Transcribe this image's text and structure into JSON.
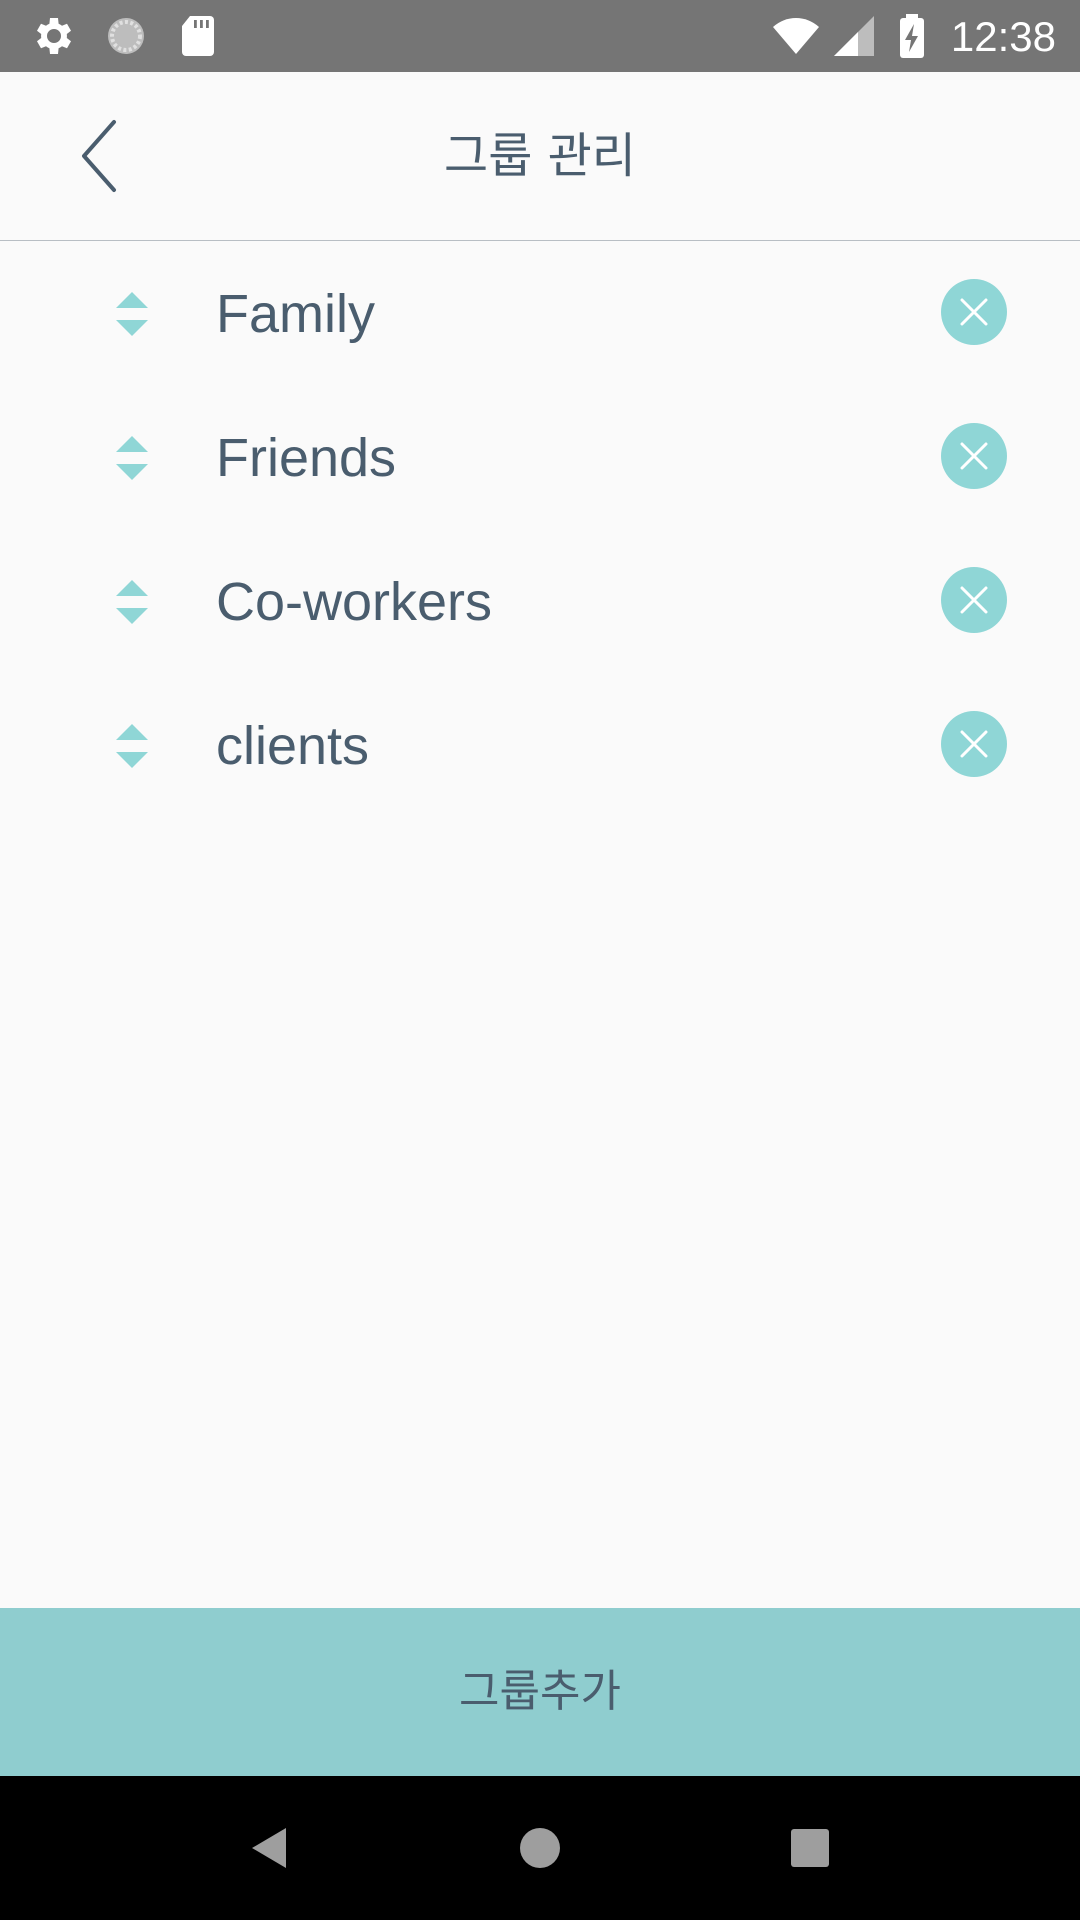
{
  "status_bar": {
    "time": "12:38",
    "icons": [
      "settings-icon",
      "loading-icon",
      "sd-card-icon",
      "wifi-icon",
      "cell-signal-icon",
      "battery-charging-icon"
    ]
  },
  "header": {
    "title": "그룹 관리",
    "back_icon": "chevron-left-icon"
  },
  "groups": [
    {
      "name": "Family"
    },
    {
      "name": "Friends"
    },
    {
      "name": "Co-workers"
    },
    {
      "name": "clients"
    }
  ],
  "add_group_button": {
    "label": "그룹추가"
  },
  "colors": {
    "accent": "#8fd6d6",
    "add_button_bg": "#8fcdcf",
    "text": "#4a5d6e",
    "status_bar": "#757575",
    "nav_bar": "#000000"
  },
  "nav_bar": {
    "icons": [
      "back-triangle-icon",
      "home-circle-icon",
      "recents-square-icon"
    ]
  }
}
